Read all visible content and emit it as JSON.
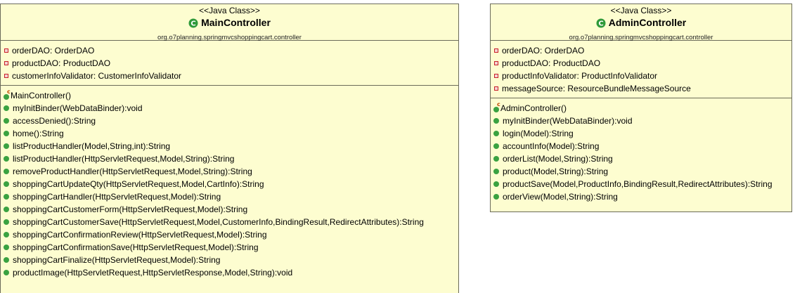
{
  "classes": [
    {
      "stereotype": "<<Java Class>>",
      "name": "MainController",
      "package": "org.o7planning.springmvcshoppingcart.controller",
      "attributes": [
        "orderDAO: OrderDAO",
        "productDAO: ProductDAO",
        "customerInfoValidator: CustomerInfoValidator"
      ],
      "constructor": "MainController()",
      "methods": [
        "myInitBinder(WebDataBinder):void",
        "accessDenied():String",
        "home():String",
        "listProductHandler(Model,String,int):String",
        "listProductHandler(HttpServletRequest,Model,String):String",
        "removeProductHandler(HttpServletRequest,Model,String):String",
        "shoppingCartUpdateQty(HttpServletRequest,Model,CartInfo):String",
        "shoppingCartHandler(HttpServletRequest,Model):String",
        "shoppingCartCustomerForm(HttpServletRequest,Model):String",
        "shoppingCartCustomerSave(HttpServletRequest,Model,CustomerInfo,BindingResult,RedirectAttributes):String",
        "shoppingCartConfirmationReview(HttpServletRequest,Model):String",
        "shoppingCartConfirmationSave(HttpServletRequest,Model):String",
        "shoppingCartFinalize(HttpServletRequest,Model):String",
        "productImage(HttpServletRequest,HttpServletResponse,Model,String):void"
      ]
    },
    {
      "stereotype": "<<Java Class>>",
      "name": "AdminController",
      "package": "org.o7planning.springmvcshoppingcart.controller",
      "attributes": [
        "orderDAO: OrderDAO",
        "productDAO: ProductDAO",
        "productInfoValidator: ProductInfoValidator",
        "messageSource: ResourceBundleMessageSource"
      ],
      "constructor": "AdminController()",
      "methods": [
        "myInitBinder(WebDataBinder):void",
        "login(Model):String",
        "accountInfo(Model):String",
        "orderList(Model,String):String",
        "product(Model,String):String",
        "productSave(Model,ProductInfo,BindingResult,RedirectAttributes):String",
        "orderView(Model,String):String"
      ]
    }
  ],
  "colors": {
    "class_fill": "#fdfdd0",
    "border": "#6b6b5a",
    "private": "#c8202a",
    "public": "#3aa241",
    "class_icon": "#2f9a3a"
  },
  "icons": {
    "class": "class-c-icon",
    "private": "private-field-icon",
    "public": "public-method-icon",
    "constructor": "constructor-icon"
  }
}
